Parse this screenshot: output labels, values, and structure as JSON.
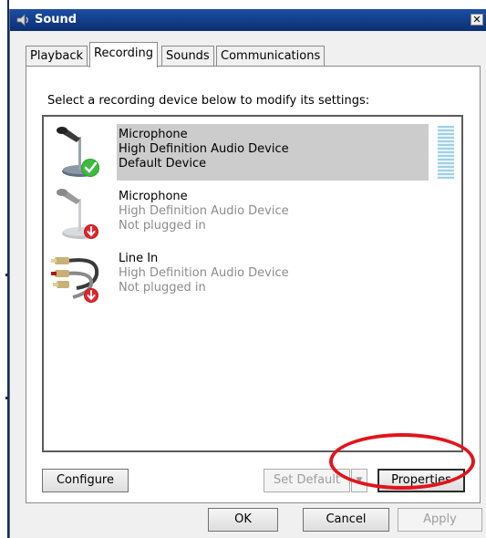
{
  "window": {
    "title": "Sound",
    "close_glyph": "✕"
  },
  "tabs": [
    {
      "label": "Playback",
      "active": false
    },
    {
      "label": "Recording",
      "active": true
    },
    {
      "label": "Sounds",
      "active": false
    },
    {
      "label": "Communications",
      "active": false
    }
  ],
  "panel": {
    "instruction": "Select a recording device below to modify its settings:"
  },
  "devices": [
    {
      "name": "Microphone",
      "driver": "High Definition Audio Device",
      "status": "Default Device",
      "selected": true,
      "icon": "microphone-icon",
      "badge": "default-check-icon"
    },
    {
      "name": "Microphone",
      "driver": "High Definition Audio Device",
      "status": "Not plugged in",
      "selected": false,
      "icon": "microphone-icon",
      "badge": "unplugged-icon"
    },
    {
      "name": "Line In",
      "driver": "High Definition Audio Device",
      "status": "Not plugged in",
      "selected": false,
      "icon": "line-in-cable-icon",
      "badge": "unplugged-icon"
    }
  ],
  "buttons": {
    "configure": "Configure",
    "set_default": "Set Default",
    "set_default_dropdown": "▼",
    "properties": "Properties",
    "ok": "OK",
    "cancel": "Cancel",
    "apply": "Apply"
  },
  "colors": {
    "titlebar": "#0b2f73",
    "selection": "#cccccc",
    "highlight": "#e2141b"
  }
}
